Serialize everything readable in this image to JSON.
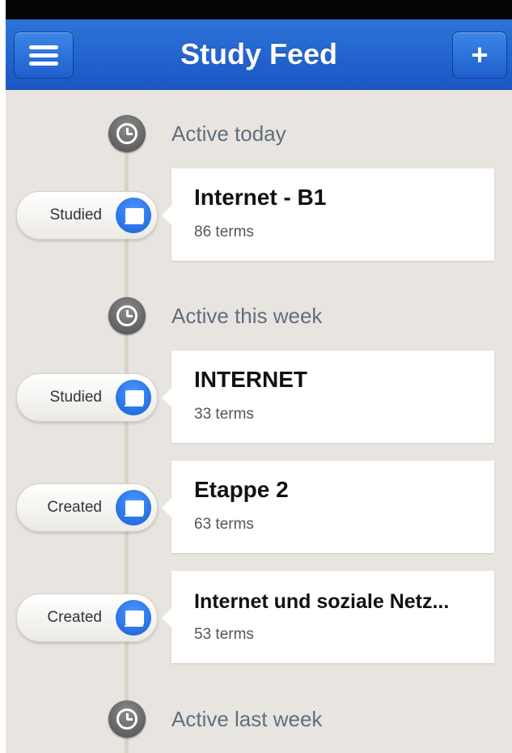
{
  "nav": {
    "title": "Study Feed",
    "add_label": "+"
  },
  "sections": [
    {
      "label": "Active today",
      "items": [
        {
          "action": "Studied",
          "title": "Internet - B1",
          "terms": "86 terms"
        }
      ]
    },
    {
      "label": "Active this week",
      "items": [
        {
          "action": "Studied",
          "title": "INTERNET",
          "terms": "33 terms"
        },
        {
          "action": "Created",
          "title": "Etappe 2",
          "terms": "63 terms"
        },
        {
          "action": "Created",
          "title": "Internet und soziale Netz...",
          "terms": "53 terms"
        }
      ]
    },
    {
      "label": "Active last week",
      "items": []
    }
  ],
  "icons": {
    "menu": "menu-icon",
    "add": "plus-icon",
    "section": "clock-icon",
    "item": "study-set-icon"
  },
  "colors": {
    "nav_blue": "#1f63d1",
    "background": "#e8e4df",
    "accent_blue": "#2a7ae6",
    "section_text": "#5f6f7f"
  }
}
